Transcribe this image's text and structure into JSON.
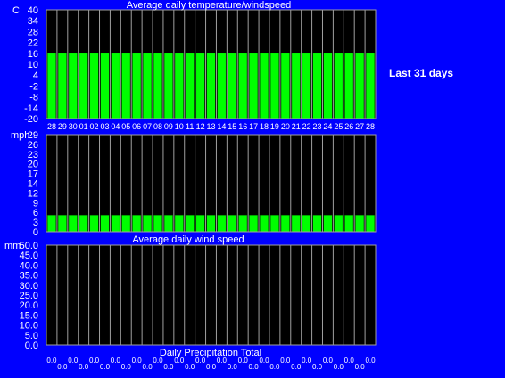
{
  "side_label": "Last 31 days",
  "colors": {
    "background": "#0000ff",
    "plot_background": "#000000",
    "bar": "#00ff00",
    "grid": "#a0a0a0",
    "text": "#ffffff"
  },
  "chart_data": [
    {
      "type": "bar",
      "title": "Average daily temperature/windspeed",
      "unit": "C",
      "categories": [
        "28",
        "29",
        "30",
        "01",
        "02",
        "03",
        "04",
        "05",
        "06",
        "07",
        "08",
        "09",
        "10",
        "11",
        "12",
        "13",
        "14",
        "15",
        "16",
        "17",
        "18",
        "19",
        "20",
        "21",
        "22",
        "23",
        "24",
        "25",
        "26",
        "27",
        "28"
      ],
      "values": [
        16,
        16,
        16,
        16,
        16,
        16,
        16,
        16,
        16,
        16,
        16,
        16,
        16,
        16,
        16,
        16,
        16,
        16,
        16,
        16,
        16,
        16,
        16,
        16,
        16,
        16,
        16,
        16,
        16,
        16,
        16
      ],
      "ylim": [
        -20,
        40
      ],
      "yticks": [
        "40",
        "34",
        "28",
        "22",
        "16",
        "10",
        "4",
        "-2",
        "-8",
        "-14",
        "-20"
      ],
      "grid": true
    },
    {
      "type": "bar",
      "title": "Average daily wind speed",
      "unit": "mph",
      "categories": [
        "28",
        "29",
        "30",
        "01",
        "02",
        "03",
        "04",
        "05",
        "06",
        "07",
        "08",
        "09",
        "10",
        "11",
        "12",
        "13",
        "14",
        "15",
        "16",
        "17",
        "18",
        "19",
        "20",
        "21",
        "22",
        "23",
        "24",
        "25",
        "26",
        "27",
        "28"
      ],
      "values": [
        5,
        5,
        5,
        5,
        5,
        5,
        5,
        5,
        5,
        5,
        5,
        5,
        5,
        5,
        5,
        5,
        5,
        5,
        5,
        5,
        5,
        5,
        5,
        5,
        5,
        5,
        5,
        5,
        5,
        5,
        5
      ],
      "ylim": [
        0,
        29
      ],
      "yticks": [
        "29",
        "26",
        "23",
        "20",
        "17",
        "14",
        "12",
        "9",
        "6",
        "3",
        "0"
      ],
      "grid": true
    },
    {
      "type": "bar",
      "title": "Daily Precipitation Total",
      "unit": "mm",
      "value_labels": [
        "0.0",
        "0.0",
        "0.0",
        "0.0",
        "0.0",
        "0.0",
        "0.0",
        "0.0",
        "0.0",
        "0.0",
        "0.0",
        "0.0",
        "0.0",
        "0.0",
        "0.0",
        "0.0",
        "0.0",
        "0.0",
        "0.0",
        "0.0",
        "0.0",
        "0.0",
        "0.0",
        "0.0",
        "0.0",
        "0.0",
        "0.0",
        "0.0",
        "0.0",
        "0.0",
        "0.0"
      ],
      "values": [
        0,
        0,
        0,
        0,
        0,
        0,
        0,
        0,
        0,
        0,
        0,
        0,
        0,
        0,
        0,
        0,
        0,
        0,
        0,
        0,
        0,
        0,
        0,
        0,
        0,
        0,
        0,
        0,
        0,
        0,
        0
      ],
      "ylim": [
        0,
        50
      ],
      "yticks": [
        "50.0",
        "45.0",
        "40.0",
        "35.0",
        "30.0",
        "25.0",
        "20.0",
        "15.0",
        "10.0",
        "5.0",
        "0.0"
      ],
      "grid": true
    }
  ]
}
